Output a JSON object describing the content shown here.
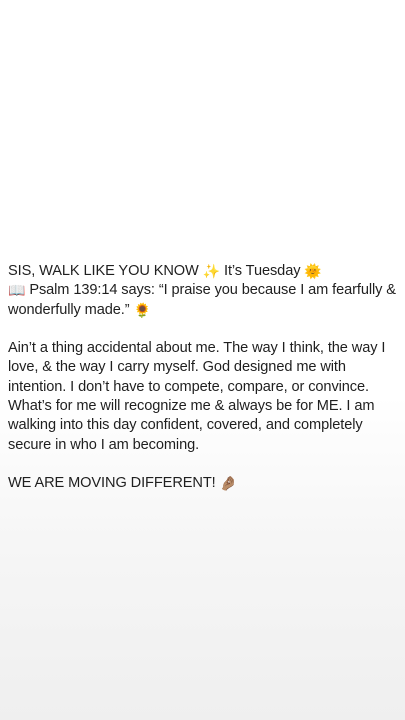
{
  "post": {
    "heading": {
      "text": "SIS, WALK LIKE YOU KNOW",
      "sparkle_emoji": "✨",
      "day_text": "It’s Tuesday",
      "sun_emoji": "🌞"
    },
    "verse": {
      "book_emoji": "📖",
      "text": "Psalm 139:14 says: “I praise you because I am fearfully & wonderfully made.”",
      "sunflower_emoji": "🌻"
    },
    "body": "Ain’t a thing accidental about me. The way I think, the way I love, & the way I carry myself. God designed me with intention. I don’t have to compete, compare, or convince. What’s for me will recognize me & always be for ME. I am walking into this day confident, covered, and completely secure in who I am becoming.",
    "closing": {
      "text": "WE ARE MOVING DIFFERENT!",
      "pinch_emoji": "🤌🏽"
    }
  }
}
